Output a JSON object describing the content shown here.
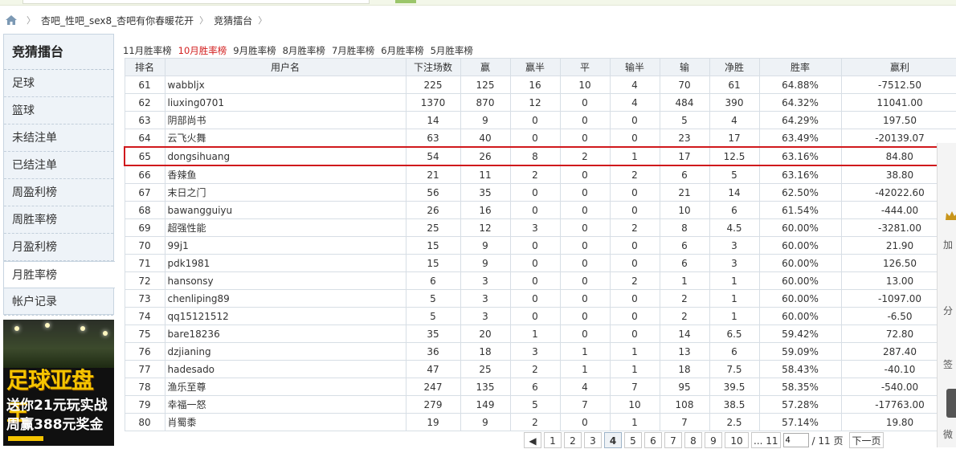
{
  "breadcrumb": {
    "items": [
      "杏吧_性吧_sex8_杏吧有你春暖花开",
      "竞猜擂台"
    ]
  },
  "sidebar": {
    "title": "竞猜擂台",
    "items": [
      {
        "label": "足球"
      },
      {
        "label": "篮球"
      },
      {
        "label": "未结注单"
      },
      {
        "label": "已结注单"
      },
      {
        "label": "周盈利榜"
      },
      {
        "label": "周胜率榜"
      },
      {
        "label": "月盈利榜"
      },
      {
        "label": "月胜率榜",
        "active": true
      },
      {
        "label": "帐户记录"
      }
    ]
  },
  "banner": {
    "headline": "足球亚盘王",
    "line1": "送你21元玩实战",
    "line2": "周赢388元奖金"
  },
  "month_tabs": [
    {
      "label": "11月胜率榜"
    },
    {
      "label": "10月胜率榜",
      "active": true
    },
    {
      "label": "9月胜率榜"
    },
    {
      "label": "8月胜率榜"
    },
    {
      "label": "7月胜率榜"
    },
    {
      "label": "6月胜率榜"
    },
    {
      "label": "5月胜率榜"
    }
  ],
  "table": {
    "headers": [
      "排名",
      "用户名",
      "下注场数",
      "赢",
      "赢半",
      "平",
      "输半",
      "输",
      "净胜",
      "胜率",
      "赢利"
    ],
    "rows": [
      [
        "61",
        "wabbljx",
        "225",
        "125",
        "16",
        "10",
        "4",
        "70",
        "61",
        "64.88%",
        "-7512.50"
      ],
      [
        "62",
        "liuxing0701",
        "1370",
        "870",
        "12",
        "0",
        "4",
        "484",
        "390",
        "64.32%",
        "11041.00"
      ],
      [
        "63",
        "阴部尚书",
        "14",
        "9",
        "0",
        "0",
        "0",
        "5",
        "4",
        "64.29%",
        "197.50"
      ],
      [
        "64",
        "云飞火舞",
        "63",
        "40",
        "0",
        "0",
        "0",
        "23",
        "17",
        "63.49%",
        "-20139.07"
      ],
      [
        "65",
        "dongsihuang",
        "54",
        "26",
        "8",
        "2",
        "1",
        "17",
        "12.5",
        "63.16%",
        "84.80"
      ],
      [
        "66",
        "香辣鱼",
        "21",
        "11",
        "2",
        "0",
        "2",
        "6",
        "5",
        "63.16%",
        "38.80"
      ],
      [
        "67",
        "末日之门",
        "56",
        "35",
        "0",
        "0",
        "0",
        "21",
        "14",
        "62.50%",
        "-42022.60"
      ],
      [
        "68",
        "bawangguiyu",
        "26",
        "16",
        "0",
        "0",
        "0",
        "10",
        "6",
        "61.54%",
        "-444.00"
      ],
      [
        "69",
        "超强性能",
        "25",
        "12",
        "3",
        "0",
        "2",
        "8",
        "4.5",
        "60.00%",
        "-3281.00"
      ],
      [
        "70",
        "99j1",
        "15",
        "9",
        "0",
        "0",
        "0",
        "6",
        "3",
        "60.00%",
        "21.90"
      ],
      [
        "71",
        "pdk1981",
        "15",
        "9",
        "0",
        "0",
        "0",
        "6",
        "3",
        "60.00%",
        "126.50"
      ],
      [
        "72",
        "hansonsy",
        "6",
        "3",
        "0",
        "0",
        "2",
        "1",
        "1",
        "60.00%",
        "13.00"
      ],
      [
        "73",
        "chenliping89",
        "5",
        "3",
        "0",
        "0",
        "0",
        "2",
        "1",
        "60.00%",
        "-1097.00"
      ],
      [
        "74",
        "qq15121512",
        "5",
        "3",
        "0",
        "0",
        "0",
        "2",
        "1",
        "60.00%",
        "-6.50"
      ],
      [
        "75",
        "bare18236",
        "35",
        "20",
        "1",
        "0",
        "0",
        "14",
        "6.5",
        "59.42%",
        "72.80"
      ],
      [
        "76",
        "dzjianing",
        "36",
        "18",
        "3",
        "1",
        "1",
        "13",
        "6",
        "59.09%",
        "287.40"
      ],
      [
        "77",
        "hadesado",
        "47",
        "25",
        "2",
        "1",
        "1",
        "18",
        "7.5",
        "58.43%",
        "-40.10"
      ],
      [
        "78",
        "渔乐至尊",
        "247",
        "135",
        "6",
        "4",
        "7",
        "95",
        "39.5",
        "58.35%",
        "-540.00"
      ],
      [
        "79",
        "幸福一怒",
        "279",
        "149",
        "5",
        "7",
        "10",
        "108",
        "38.5",
        "57.28%",
        "-17763.00"
      ],
      [
        "80",
        "肖蜀黍",
        "19",
        "9",
        "2",
        "0",
        "1",
        "7",
        "2.5",
        "57.14%",
        "19.80"
      ]
    ],
    "highlight_index": 4
  },
  "float_panel": {
    "items": [
      "加",
      "分",
      "签",
      "微"
    ]
  },
  "pager": {
    "prev": "◀",
    "pages": [
      "1",
      "2",
      "3",
      "4",
      "5",
      "6",
      "7",
      "8",
      "9",
      "10",
      "... 11"
    ],
    "current": "4",
    "input_value": "4",
    "total": "/ 11 页",
    "next": "下一页"
  }
}
